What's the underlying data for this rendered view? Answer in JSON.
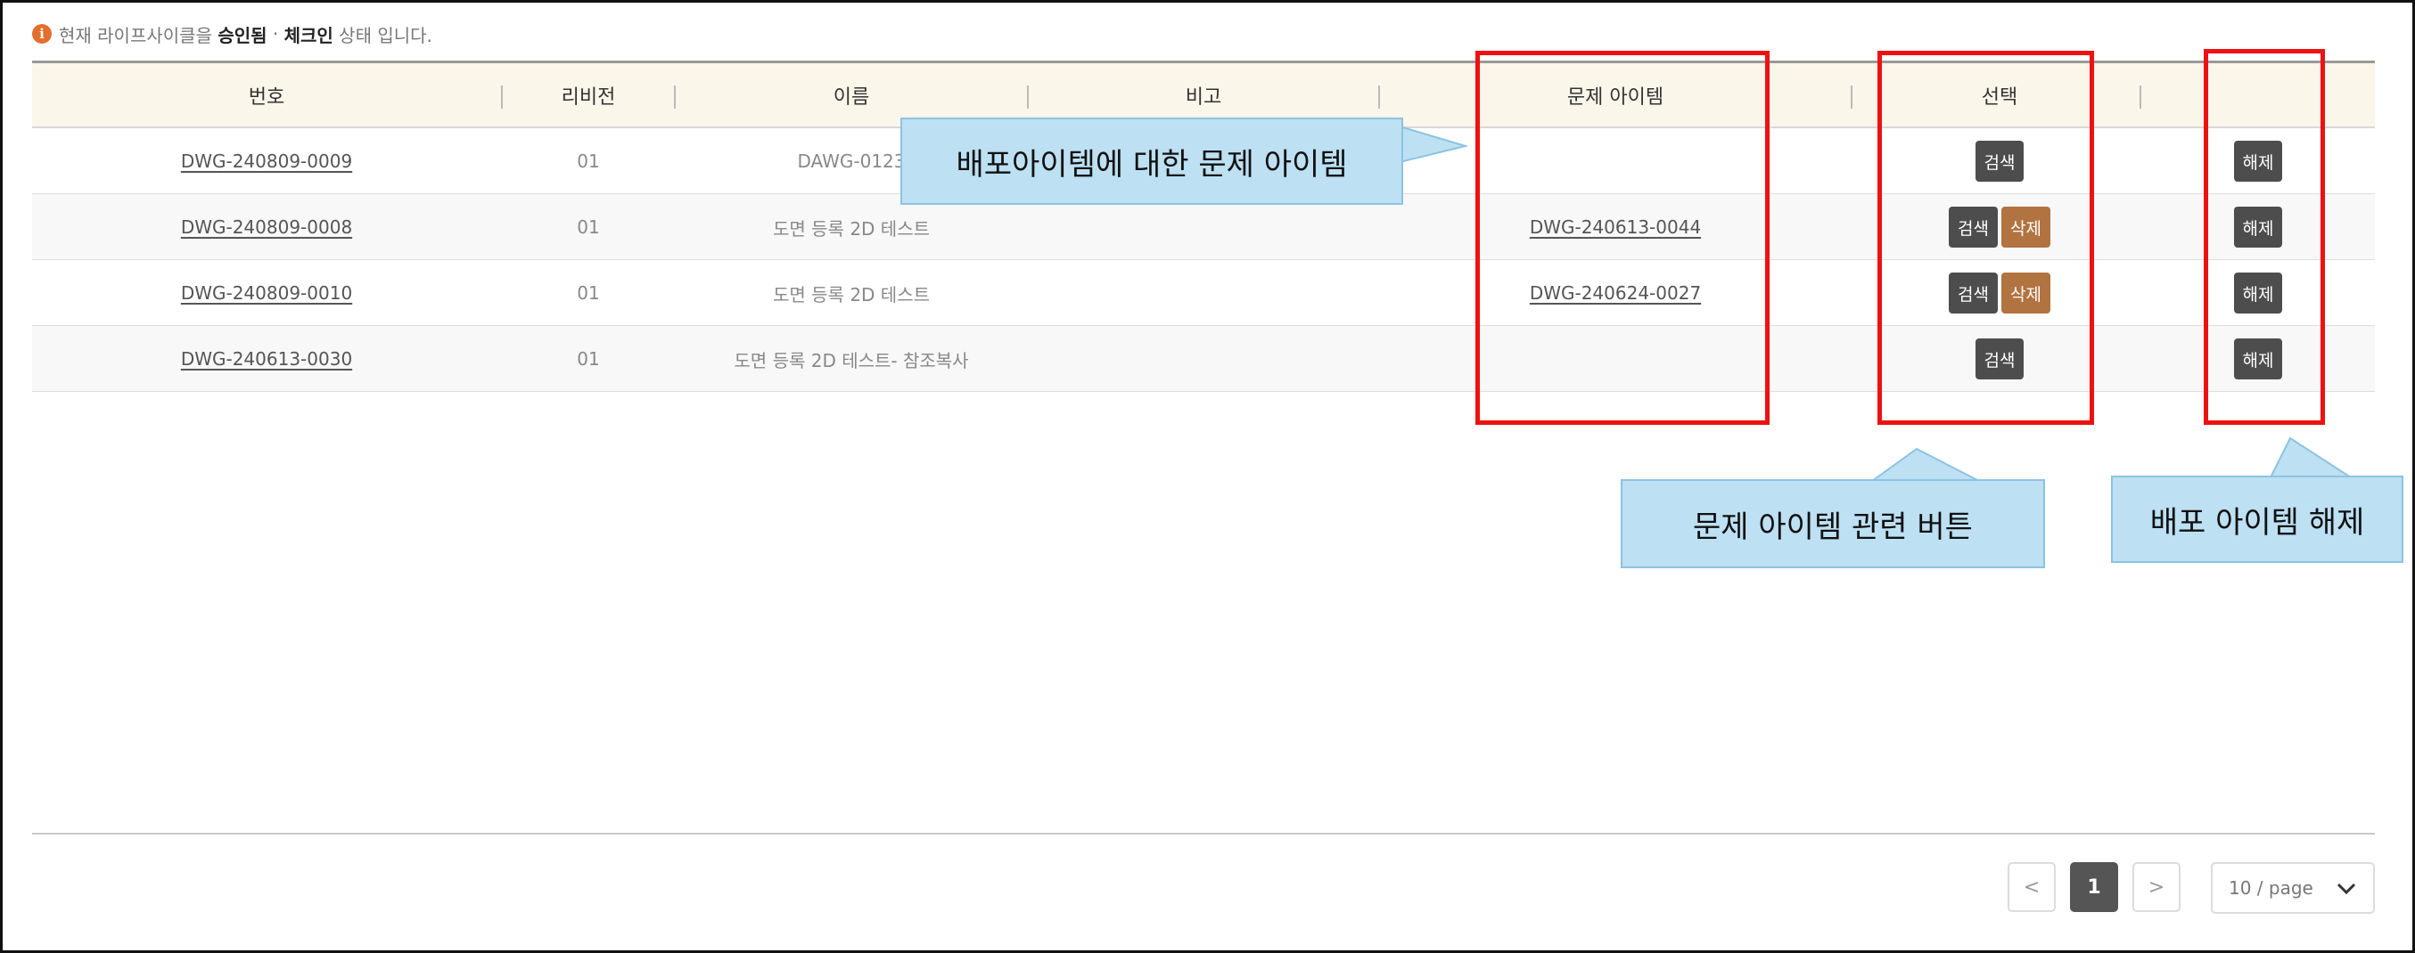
{
  "status": {
    "prefix": "현재 라이프사이클",
    "postposition": "을",
    "lifecycle": "승인됨",
    "separator": "·",
    "state": "체크인",
    "suffix": "상태 입니다."
  },
  "table": {
    "headers": {
      "number": "번호",
      "revision": "리비전",
      "name": "이름",
      "note": "비고",
      "problem_item": "문제 아이템",
      "select": "선택",
      "release": ""
    },
    "rows": [
      {
        "number": "DWG-240809-0009",
        "revision": "01",
        "name": "DAWG-0123",
        "problem_item": "",
        "actions": [
          "검색"
        ],
        "release": "해제"
      },
      {
        "number": "DWG-240809-0008",
        "revision": "01",
        "name": "도면 등록 2D 테스트",
        "problem_item": "DWG-240613-0044",
        "actions": [
          "검색",
          "삭제"
        ],
        "release": "해제"
      },
      {
        "number": "DWG-240809-0010",
        "revision": "01",
        "name": "도면 등록 2D 테스트",
        "problem_item": "DWG-240624-0027",
        "actions": [
          "검색",
          "삭제"
        ],
        "release": "해제"
      },
      {
        "number": "DWG-240613-0030",
        "revision": "01",
        "name": "도면 등록 2D 테스트- 참조복사",
        "problem_item": "",
        "actions": [
          "검색"
        ],
        "release": "해제"
      }
    ]
  },
  "annotations": {
    "problem_item": "배포아이템에 대한 문제 아이템",
    "problem_buttons": "문제 아이템 관련 버튼",
    "release_item": "배포 아이템 해제"
  },
  "pagination": {
    "prev": "<",
    "current": "1",
    "next": ">",
    "page_size": "10 / page"
  },
  "colors": {
    "info_icon": "#e36f2c",
    "header_bg": "#fbf6ea",
    "button_dark": "#4d4d4d",
    "button_brown": "#b17340",
    "highlight_red": "#ee1111",
    "callout_bg": "#bde0f3"
  }
}
